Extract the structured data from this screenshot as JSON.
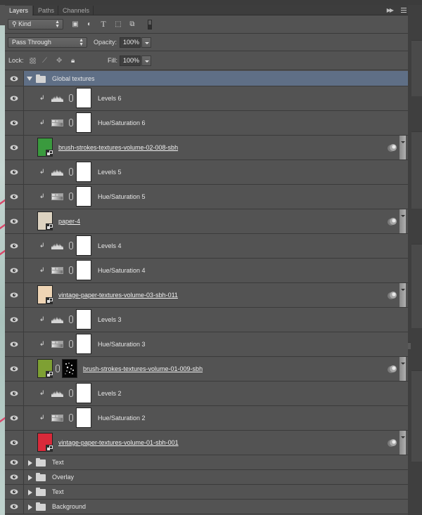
{
  "panel": {
    "tabs": [
      {
        "label": "Layers",
        "active": true
      },
      {
        "label": "Paths",
        "active": false
      },
      {
        "label": "Channels",
        "active": false
      }
    ],
    "collapse_icon": "double-arrow-right-icon",
    "menu_icon": "panel-menu-icon"
  },
  "filter": {
    "kind_label": "Kind",
    "icons": [
      "pixel-filter-icon",
      "adjustment-filter-icon",
      "type-filter-icon",
      "shape-filter-icon",
      "smart-object-filter-icon",
      "filter-toggle-icon"
    ]
  },
  "blend": {
    "mode": "Pass Through",
    "opacity_label": "Opacity:",
    "opacity_value": "100%"
  },
  "lock": {
    "label": "Lock:",
    "icons": [
      "lock-transparent-icon",
      "lock-paint-icon",
      "lock-position-icon",
      "lock-all-icon"
    ],
    "fill_label": "Fill:",
    "fill_value": "100%"
  },
  "layers": [
    {
      "type": "group",
      "name": "Global textures",
      "expanded": true,
      "selected": true,
      "visible": true
    },
    {
      "type": "adjustment",
      "adj": "levels",
      "name": "Levels 6",
      "clipped": true,
      "visible": true
    },
    {
      "type": "adjustment",
      "adj": "hue",
      "name": "Hue/Saturation 6",
      "clipped": true,
      "visible": true
    },
    {
      "type": "smart",
      "name": "brush-strokes-textures-volume-02-008-sbh",
      "thumb_color": "#3a9a3e",
      "has_fx": true,
      "visible": true
    },
    {
      "type": "adjustment",
      "adj": "levels",
      "name": "Levels 5",
      "clipped": true,
      "visible": true
    },
    {
      "type": "adjustment",
      "adj": "hue",
      "name": "Hue/Saturation 5",
      "clipped": true,
      "visible": true
    },
    {
      "type": "smart",
      "name": "paper-4",
      "thumb_color": "#ddd3c1",
      "has_fx": true,
      "visible": true
    },
    {
      "type": "adjustment",
      "adj": "levels",
      "name": "Levels 4",
      "clipped": true,
      "visible": true
    },
    {
      "type": "adjustment",
      "adj": "hue",
      "name": "Hue/Saturation 4",
      "clipped": true,
      "visible": true
    },
    {
      "type": "smart",
      "name": "vintage-paper-textures-volume-03-sbh-011",
      "thumb_color": "#efd5b5",
      "has_fx": true,
      "visible": true
    },
    {
      "type": "adjustment",
      "adj": "levels",
      "name": "Levels 3",
      "clipped": true,
      "visible": true
    },
    {
      "type": "adjustment",
      "adj": "hue",
      "name": "Hue/Saturation 3",
      "clipped": true,
      "visible": true
    },
    {
      "type": "smart",
      "name": "brush-strokes-textures-volume-01-009-sbh",
      "thumb_color": "#7ea033",
      "has_mask": true,
      "has_fx": true,
      "visible": true
    },
    {
      "type": "adjustment",
      "adj": "levels",
      "name": "Levels 2",
      "clipped": true,
      "visible": true
    },
    {
      "type": "adjustment",
      "adj": "hue",
      "name": "Hue/Saturation 2",
      "clipped": true,
      "visible": true
    },
    {
      "type": "smart",
      "name": "vintage-paper-textures-volume-01-sbh-001",
      "thumb_color": "#d92a3a",
      "has_fx": true,
      "visible": true
    },
    {
      "type": "group",
      "name": "Text",
      "expanded": false,
      "visible": true
    },
    {
      "type": "group",
      "name": "Overlay",
      "expanded": false,
      "visible": true
    },
    {
      "type": "group",
      "name": "Text",
      "expanded": false,
      "visible": true
    },
    {
      "type": "group",
      "name": "Background",
      "expanded": false,
      "visible": true
    }
  ]
}
